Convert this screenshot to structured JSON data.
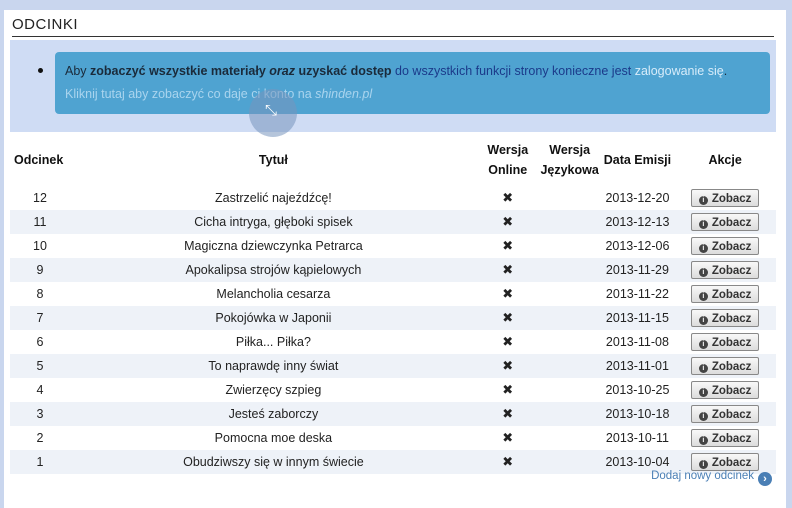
{
  "section": {
    "title": "ODCINKI"
  },
  "notice": {
    "p1": "Aby ",
    "p2": "zobaczyć wszystkie materiały",
    "p3": " ",
    "p4": "oraz",
    "p5": " uzyskać dostęp",
    "p6": " do wszystkich funkcji strony konieczne jest ",
    "p7": "zalogowanie się",
    "p8": ".",
    "l2a": "Kliknij tutaj aby zobaczyć co daje ci konto na ",
    "l2b": "shinden.pl"
  },
  "table": {
    "headers": {
      "num": "Odcinek",
      "title": "Tytuł",
      "online_1": "Wersja",
      "online_2": "Online",
      "lang_1": "Wersja",
      "lang_2": "Językowa",
      "date": "Data Emisji",
      "actions": "Akcje"
    },
    "rows": [
      {
        "num": "12",
        "title": "Zastrzelić najeźdźcę!",
        "online": "✖",
        "date": "2013-12-20",
        "button": "Zobacz"
      },
      {
        "num": "11",
        "title": "Cicha intryga, głęboki spisek",
        "online": "✖",
        "date": "2013-12-13",
        "button": "Zobacz"
      },
      {
        "num": "10",
        "title": "Magiczna dziewczynka Petrarca",
        "online": "✖",
        "date": "2013-12-06",
        "button": "Zobacz"
      },
      {
        "num": "9",
        "title": "Apokalipsa strojów kąpielowych",
        "online": "✖",
        "date": "2013-11-29",
        "button": "Zobacz"
      },
      {
        "num": "8",
        "title": "Melancholia cesarza",
        "online": "✖",
        "date": "2013-11-22",
        "button": "Zobacz"
      },
      {
        "num": "7",
        "title": "Pokojówka w Japonii",
        "online": "✖",
        "date": "2013-11-15",
        "button": "Zobacz"
      },
      {
        "num": "6",
        "title": "Piłka... Piłka?",
        "online": "✖",
        "date": "2013-11-08",
        "button": "Zobacz"
      },
      {
        "num": "5",
        "title": "To naprawdę inny świat",
        "online": "✖",
        "date": "2013-11-01",
        "button": "Zobacz"
      },
      {
        "num": "4",
        "title": "Zwierzęcy szpieg",
        "online": "✖",
        "date": "2013-10-25",
        "button": "Zobacz"
      },
      {
        "num": "3",
        "title": "Jesteś zaborczy",
        "online": "✖",
        "date": "2013-10-18",
        "button": "Zobacz"
      },
      {
        "num": "2",
        "title": "Pomocna moe deska",
        "online": "✖",
        "date": "2013-10-11",
        "button": "Zobacz"
      },
      {
        "num": "1",
        "title": "Obudziwszy się w innym świecie",
        "online": "✖",
        "date": "2013-10-04",
        "button": "Zobacz"
      }
    ]
  },
  "footer": {
    "add_label": "Dodaj nowy odcinek",
    "add_icon": "chevron-right-icon"
  },
  "icons": {
    "info": "i",
    "arrow": "›",
    "cursor": "⤡"
  },
  "colors": {
    "notice_bg": "#4fa3d1",
    "page_bg": "#c9d6ee",
    "link": "#4a7fb5"
  }
}
